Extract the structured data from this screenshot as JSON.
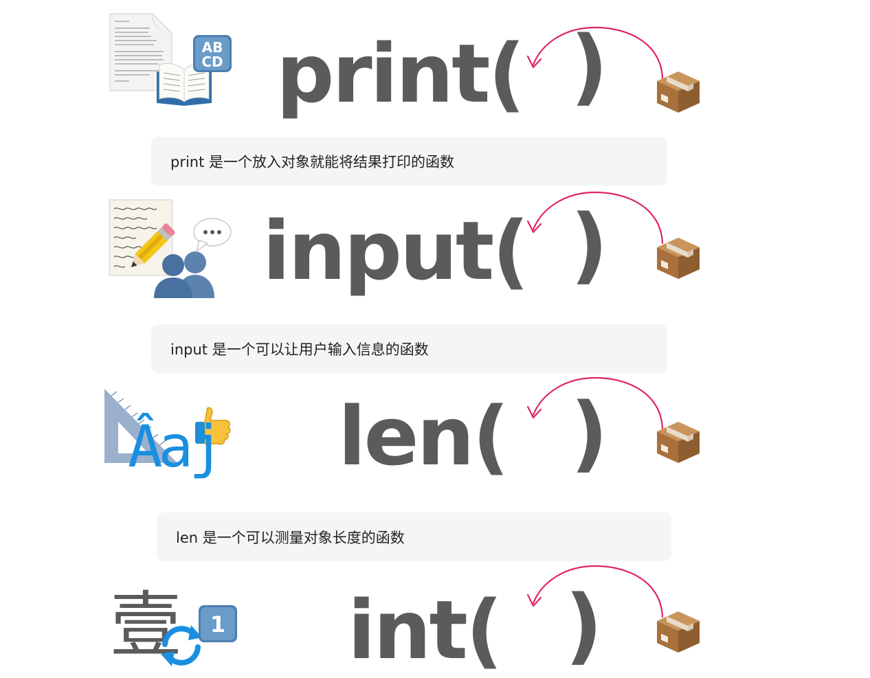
{
  "rows": [
    {
      "func": "print(",
      "close": ")",
      "caption": "print 是一个放入对象就能将结果打印的函数",
      "icons": [
        "document-icon",
        "open-book-icon",
        "abcd-input-icon",
        "package-icon"
      ]
    },
    {
      "func": "input(",
      "close": ")",
      "caption": "input 是一个可以让用户输入信息的函数",
      "icons": [
        "handwritten-page-icon",
        "pencil-icon",
        "busts-in-silhouette-icon",
        "speech-bubble-icon",
        "package-icon"
      ]
    },
    {
      "func": "len(",
      "close": ")",
      "caption": "len 是一个可以测量对象长度的函数",
      "icons": [
        "triangular-ruler-icon",
        "thumbs-up-icon",
        "font-sample-icon",
        "package-icon"
      ]
    },
    {
      "func": "int(",
      "close": ")",
      "icons": [
        "chinese-numeral-icon",
        "refresh-arrows-icon",
        "keycap-one-icon",
        "package-icon"
      ],
      "numeral_glyph": "壹",
      "keycap_digit": "1",
      "font_sample": "Âaj",
      "abcd_top": "AB",
      "abcd_bottom": "CD"
    }
  ],
  "colors": {
    "text": "#5b5b5b",
    "arrow": "#e0245e",
    "caption_bg": "#f5f5f5",
    "box": "#b07a45",
    "blue": "#1a8fe0"
  }
}
